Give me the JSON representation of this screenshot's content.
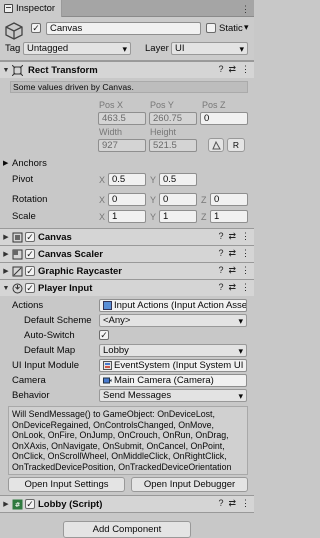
{
  "tab": {
    "title": "Inspector"
  },
  "gameobject": {
    "name": "Canvas",
    "static_label": "Static",
    "tag_label": "Tag",
    "tag_value": "Untagged",
    "layer_label": "Layer",
    "layer_value": "UI"
  },
  "rect_transform": {
    "title": "Rect Transform",
    "note": "Some values driven by Canvas.",
    "pos_x_label": "Pos X",
    "pos_y_label": "Pos Y",
    "pos_z_label": "Pos Z",
    "pos_x": "463.5",
    "pos_y": "260.75",
    "pos_z": "0",
    "width_label": "Width",
    "height_label": "Height",
    "width": "927",
    "height": "521.5",
    "r_button": "R",
    "anchors_label": "Anchors",
    "pivot_label": "Pivot",
    "pivot_x_label": "X",
    "pivot_x": "0.5",
    "pivot_y_label": "Y",
    "pivot_y": "0.5",
    "rotation_label": "Rotation",
    "rot_x_label": "X",
    "rot_x": "0",
    "rot_y_label": "Y",
    "rot_y": "0",
    "rot_z_label": "Z",
    "rot_z": "0",
    "scale_label": "Scale",
    "scale_x_label": "X",
    "scale_x": "1",
    "scale_y_label": "Y",
    "scale_y": "1",
    "scale_z_label": "Z",
    "scale_z": "1"
  },
  "components": {
    "canvas": "Canvas",
    "canvas_scaler": "Canvas Scaler",
    "graphic_raycaster": "Graphic Raycaster"
  },
  "player_input": {
    "title": "Player Input",
    "actions_label": "Actions",
    "actions_value": "Input Actions (Input Action Asset)",
    "default_scheme_label": "Default Scheme",
    "default_scheme_value": "<Any>",
    "auto_switch_label": "Auto-Switch",
    "default_map_label": "Default Map",
    "default_map_value": "Lobby",
    "ui_input_module_label": "UI Input Module",
    "ui_input_module_value": "EventSystem (Input System UI",
    "camera_label": "Camera",
    "camera_value": "Main Camera (Camera)",
    "behavior_label": "Behavior",
    "behavior_value": "Send Messages",
    "help_text": "Will SendMessage() to GameObject: OnDeviceLost, OnDeviceRegained, OnControlsChanged, OnMove, OnLook, OnFire, OnJump, OnCrouch, OnRun, OnDrag, OnXAxis, OnNavigate, OnSubmit, OnCancel, OnPoint, OnClick, OnScrollWheel, OnMiddleClick, OnRightClick, OnTrackedDevicePosition, OnTrackedDeviceOrientation",
    "open_settings_button": "Open Input Settings",
    "open_debugger_button": "Open Input Debugger"
  },
  "lobby_script": {
    "title": "Lobby (Script)"
  },
  "add_component_button": "Add Component"
}
